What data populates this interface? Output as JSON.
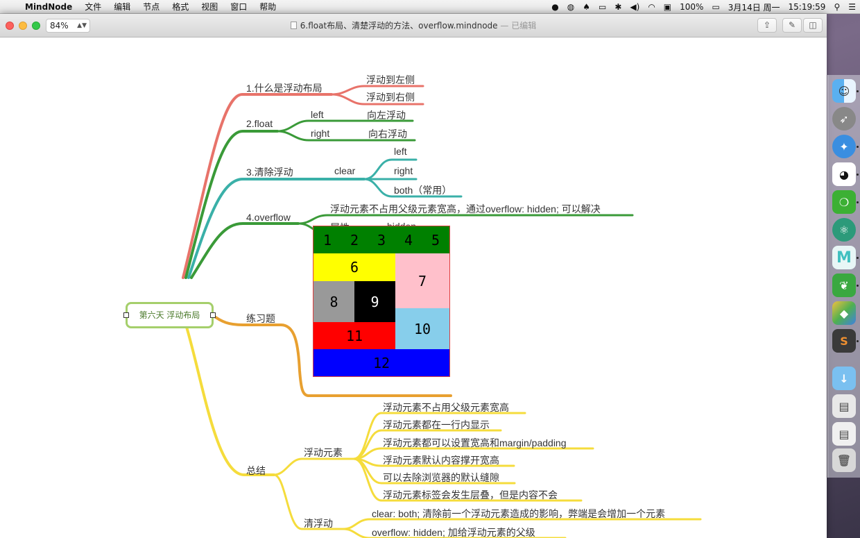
{
  "menubar": {
    "app_name": "MindNode",
    "items": [
      "文件",
      "编辑",
      "节点",
      "格式",
      "视图",
      "窗口",
      "帮助"
    ],
    "battery": "100%",
    "date": "3月14日 周一",
    "time": "15:19:59"
  },
  "window": {
    "zoom": "84%",
    "title": "6.float布局、清楚浮动的方法、overflow.mindnode",
    "edited_label": "— 已编辑"
  },
  "mindmap": {
    "root": "第六天 浮动布局",
    "b1": {
      "label": "1.什么是浮动布局",
      "children": [
        "浮动到左侧",
        "浮动到右侧"
      ]
    },
    "b2": {
      "label": "2.float",
      "left": "left",
      "right": "right",
      "left_child": "向左浮动",
      "right_child": "向右浮动"
    },
    "b3": {
      "label": "3.清除浮动",
      "clear": "clear",
      "children": [
        "left",
        "right",
        "both（常用）"
      ]
    },
    "b4": {
      "label": "4.overflow",
      "desc": "浮动元素不占用父级元素宽高，通过overflow: hidden; 可以解决",
      "attr": "属性",
      "attr_value": "hidden"
    },
    "b5": {
      "label": "练习题",
      "grid": [
        "1",
        "2",
        "3",
        "4",
        "5",
        "6",
        "7",
        "8",
        "9",
        "10",
        "11",
        "12"
      ]
    },
    "b6": {
      "label": "总结",
      "float_label": "浮动元素",
      "float_items": [
        "浮动元素不占用父级元素宽高",
        "浮动元素都在一行内显示",
        "浮动元素都可以设置宽高和margin/padding",
        "浮动元素默认内容撑开宽高",
        "可以去除浏览器的默认缝隙",
        "浮动元素标签会发生层叠，但是内容不会"
      ],
      "clear_label": "清浮动",
      "clear_items": [
        "clear: both; 清除前一个浮动元素造成的影响，弊端是会增加一个元素",
        "overflow: hidden; 加给浮动元素的父级"
      ]
    }
  },
  "colors": {
    "red_branch": "#e8736a",
    "green_branch": "#3a9a38",
    "teal_branch": "#3ab0a8",
    "orange_branch": "#e8a030",
    "yellow_branch": "#f5dc3c",
    "grid_green": "#008000",
    "grid_yellow": "#ffff00",
    "grid_pink": "#ffc0cb",
    "grid_gray": "#999999",
    "grid_black": "#000000",
    "grid_red": "#ff0000",
    "grid_lightblue": "#87ceeb",
    "grid_blue": "#0000ff"
  },
  "dock_icons": [
    "finder-icon",
    "launchpad-icon",
    "safari-icon",
    "qq-icon",
    "wechat-icon",
    "atom-icon",
    "mindnode-icon",
    "evernote-icon",
    "maps-icon",
    "sublime-icon",
    "downloads-folder-icon",
    "screenshot-thumb-icon",
    "screenshot-thumb-icon",
    "trash-icon"
  ]
}
